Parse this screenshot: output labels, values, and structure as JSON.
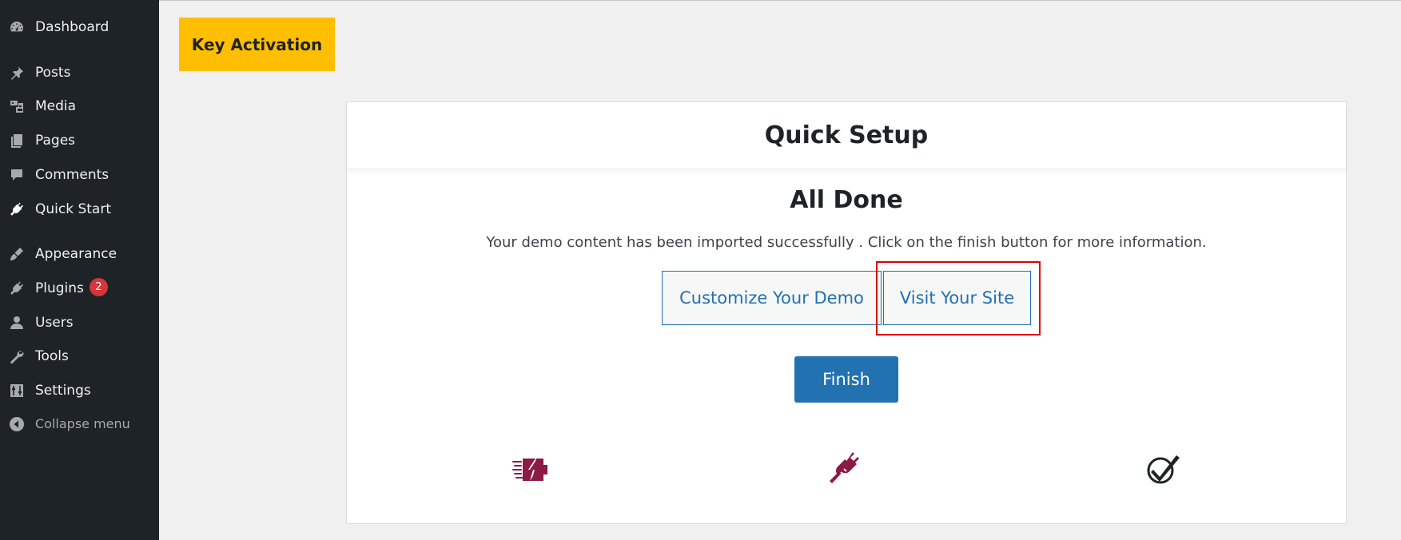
{
  "sidebar": {
    "items": [
      {
        "label": "Dashboard",
        "icon": "dashboard-icon"
      },
      {
        "label": "Posts",
        "icon": "pin-icon"
      },
      {
        "label": "Media",
        "icon": "media-icon"
      },
      {
        "label": "Pages",
        "icon": "pages-icon"
      },
      {
        "label": "Comments",
        "icon": "comment-icon"
      },
      {
        "label": "Quick Start",
        "icon": "plugin-plug-icon"
      },
      {
        "label": "Appearance",
        "icon": "paintbrush-icon"
      },
      {
        "label": "Plugins",
        "icon": "plugin-icon",
        "badge": "2"
      },
      {
        "label": "Users",
        "icon": "user-icon"
      },
      {
        "label": "Tools",
        "icon": "wrench-icon"
      },
      {
        "label": "Settings",
        "icon": "settings-icon"
      }
    ],
    "collapse_label": "Collapse menu"
  },
  "header": {
    "key_activation_label": "Key Activation"
  },
  "card": {
    "title": "Quick Setup",
    "done_title": "All Done",
    "done_text": "Your demo content has been imported successfully . Click on the finish button for more information.",
    "customize_label": "Customize Your Demo",
    "visit_label": "Visit Your Site",
    "finish_label": "Finish",
    "feature_icons": [
      "battery-charge-icon",
      "plug-icon",
      "checkmark-icon"
    ]
  },
  "colors": {
    "sidebar_bg": "#1d2327",
    "accent_yellow": "#ffbf00",
    "primary_blue": "#2271b1",
    "icon_maroon": "#8b1a45",
    "highlight_red": "#e00000",
    "badge_red": "#d63638"
  }
}
